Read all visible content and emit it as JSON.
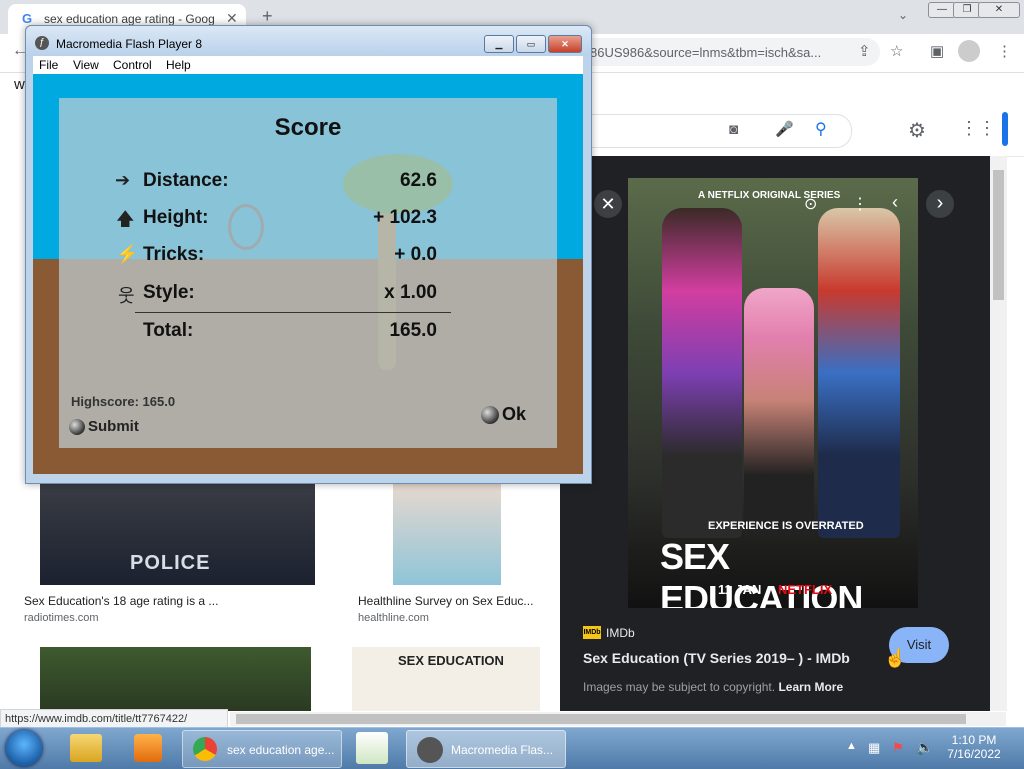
{
  "browser": {
    "tab_title": "sex education age rating - Goog",
    "url_visible": "86US986&source=lnms&tbm=isch&sa...",
    "status_url": "https://www.imdb.com/title/tt7767422/",
    "partial_letter": "w"
  },
  "results": [
    {
      "caption": "Sex Education's 18 age rating is a ...",
      "source": "radiotimes.com"
    },
    {
      "caption": "Healthline Survey on Sex Educ...",
      "source": "healthline.com"
    }
  ],
  "thumb_text": {
    "police": "POLICE",
    "book": "SEX EDUCATION"
  },
  "panel": {
    "poster_top": "A NETFLIX ORIGINAL SERIES",
    "poster_tagline": "EXPERIENCE IS OVERRATED",
    "poster_title": "SEX EDUCATION",
    "poster_date": "11 JAN",
    "poster_brand": "NETFLIX",
    "site_badge": "IMDb",
    "site_name": "IMDb",
    "title": "Sex Education (TV Series 2019– ) - IMDb",
    "visit_label": "Visit",
    "copyright_text": "Images may be subject to copyright.",
    "learn_more": "Learn More"
  },
  "flash": {
    "title": "Macromedia Flash Player 8",
    "menu": [
      "File",
      "View",
      "Control",
      "Help"
    ],
    "score_title": "Score",
    "rows": [
      {
        "label": "Distance:",
        "value": "62.6",
        "icon": "arrow-right-icon"
      },
      {
        "label": "Height:",
        "value": "+ 102.3",
        "icon": "arrow-up-icon"
      },
      {
        "label": "Tricks:",
        "value": "+ 0.0",
        "icon": "tricks-icon"
      },
      {
        "label": "Style:",
        "value": "x 1.00",
        "icon": "style-icon"
      }
    ],
    "total_label": "Total:",
    "total_value": "165.0",
    "highscore": "Highscore: 165.0",
    "submit_label": "Submit",
    "ok_label": "Ok"
  },
  "taskbar": {
    "chrome_label": "sex education age...",
    "flash_label": "Macromedia Flas...",
    "time": "1:10 PM",
    "date": "7/16/2022"
  },
  "colors": {
    "flash_sky": "#00a9e0",
    "flash_ground": "#8a5a34",
    "panel_bg": "#202124",
    "visit_button": "#8ab4f8",
    "netflix_red": "#e50914"
  }
}
